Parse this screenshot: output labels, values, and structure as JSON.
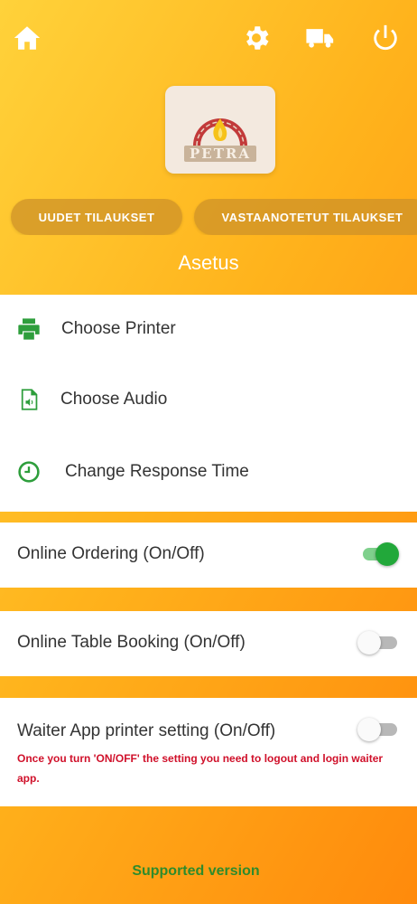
{
  "header": {
    "icons": [
      "home-icon",
      "gear-icon",
      "truck-icon",
      "power-icon"
    ],
    "logo_text": "PETRA"
  },
  "tabs": [
    {
      "label": "UUDET TILAUKSET"
    },
    {
      "label": "VASTAANOTETUT TILAUKSET"
    }
  ],
  "page_title": "Asetus",
  "menu": {
    "items": [
      {
        "label": "Choose Printer",
        "icon": "printer-icon"
      },
      {
        "label": "Choose Audio",
        "icon": "audio-file-icon"
      },
      {
        "label": "Change Response Time",
        "icon": "clock-icon"
      }
    ]
  },
  "settings": [
    {
      "label": "Online Ordering (On/Off)",
      "on": true
    },
    {
      "label": "Online Table Booking (On/Off)",
      "on": false
    },
    {
      "label": "Waiter App printer setting (On/Off)",
      "on": false,
      "note": "Once you turn 'ON/OFF' the setting you need to logout and login waiter app."
    }
  ],
  "footer": {
    "text": "Supported version"
  },
  "colors": {
    "accent_green": "#2e9e3c",
    "toggle_on": "#22a83a",
    "warning_red": "#d0102a",
    "header_gradient_start": "#ffd23a",
    "header_gradient_end": "#ff8a0c"
  }
}
